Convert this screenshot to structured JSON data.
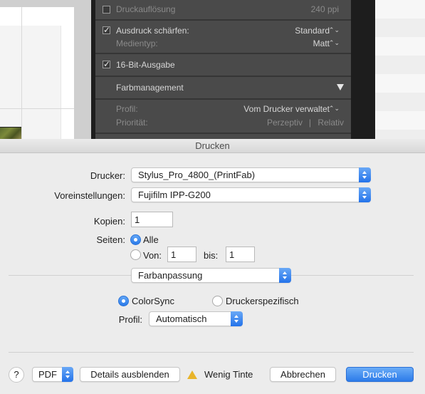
{
  "background_app": {
    "rows": [
      {
        "label": "Druckauflösung",
        "value": "240 ppi",
        "checked": false
      },
      {
        "label": "Ausdruck schärfen:",
        "value": "Standard",
        "checked": true
      },
      {
        "label": "Medientyp:",
        "value": "Matt"
      },
      {
        "label": "16-Bit-Ausgabe",
        "checked": true
      },
      {
        "label": "Farbmanagement"
      },
      {
        "label": "Profil:",
        "value": "Vom Drucker verwaltet"
      },
      {
        "label": "Priorität:",
        "value_left": "Perzeptiv",
        "value_sep": "|",
        "value_right": "Relativ"
      }
    ],
    "dropdown_glyph": "⌃⌄",
    "triangle_icon": "disclosure-triangle-down"
  },
  "dialog": {
    "title": "Drucken",
    "printer": {
      "label": "Drucker:",
      "value": "Stylus_Pro_4800_(PrintFab)"
    },
    "presets": {
      "label": "Voreinstellungen:",
      "value": "Fujifilm IPP-G200"
    },
    "copies": {
      "label": "Kopien:",
      "value": "1"
    },
    "pages": {
      "label": "Seiten:",
      "all_label": "Alle",
      "from_label": "Von:",
      "from_value": "1",
      "to_label": "bis:",
      "to_value": "1",
      "selected": "all"
    },
    "section_popup": {
      "value": "Farbanpassung"
    },
    "color_matching": {
      "colorsync_label": "ColorSync",
      "printer_specific_label": "Druckerspezifisch",
      "selected": "colorsync"
    },
    "profile": {
      "label": "Profil:",
      "value": "Automatisch"
    },
    "footer": {
      "help_label": "?",
      "pdf_label": "PDF",
      "details_label": "Details ausblenden",
      "warning_text": "Wenig Tinte",
      "cancel_label": "Abbrechen",
      "print_label": "Drucken"
    },
    "accent_color": "#2c7be9",
    "warning_color": "#e8b42a"
  }
}
